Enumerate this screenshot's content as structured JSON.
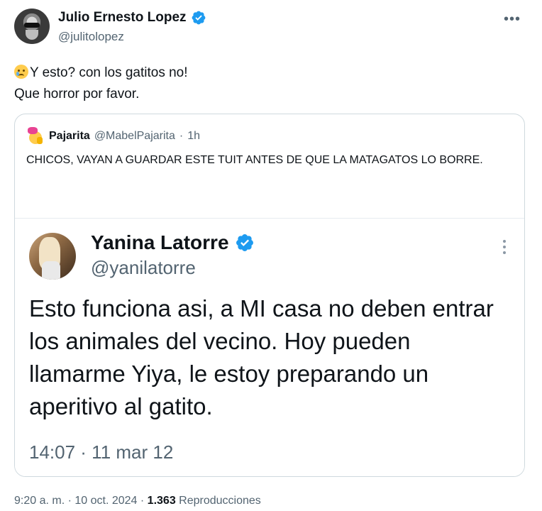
{
  "author": {
    "name": "Julio Ernesto Lopez",
    "handle": "@julitolopez",
    "verified_color": "#1d9bf0"
  },
  "more_icon": "•••",
  "tweet": {
    "line1": "Y esto? con los gatitos no!",
    "line2": "Que horror por favor."
  },
  "quote": {
    "name": "Pajarita",
    "handle": "@MabelPajarita",
    "separator": "·",
    "time": "1h",
    "text": "CHICOS, VAYAN A GUARDAR ESTE TUIT ANTES DE QUE LA MATAGATOS LO BORRE.",
    "embedded": {
      "name": "Yanina Latorre",
      "handle": "@yanilatorre",
      "text": "Esto funciona asi, a MI casa no deben entrar los animales del vecino. Hoy pueden llamarme Yiya, le estoy preparando un aperitivo al gatito.",
      "timestamp": "14:07 · 11 mar 12"
    }
  },
  "footer": {
    "time": "9:20 a. m. · 10 oct. 2024 ·",
    "views_count": "1.363",
    "views_label": "Reproducciones"
  }
}
